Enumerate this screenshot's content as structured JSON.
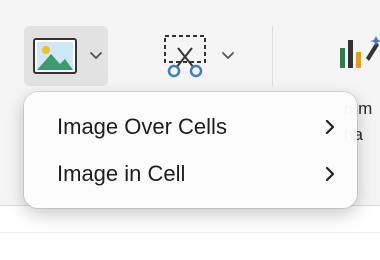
{
  "ribbon": {
    "picture_button": {
      "icon": "picture-icon",
      "dropdown_icon": "chevron-down-icon"
    },
    "screenshot_button": {
      "icon": "screenshot-scissors-icon",
      "dropdown_icon": "chevron-down-icon"
    },
    "chart_button": {
      "icon": "recommended-charts-icon",
      "label_line1": "mm",
      "label_line2": "ha"
    }
  },
  "picture_menu": {
    "items": [
      {
        "label": "Image Over Cells",
        "icon": "chevron-right-icon"
      },
      {
        "label": "Image in Cell",
        "icon": "chevron-right-icon"
      }
    ]
  },
  "colors": {
    "ribbon_bg": "#f5f5f5",
    "picture_frame": "#333333",
    "sun": "#f0c419",
    "mountain": "#3a9d6e",
    "scissors": "#3e7bd6"
  }
}
